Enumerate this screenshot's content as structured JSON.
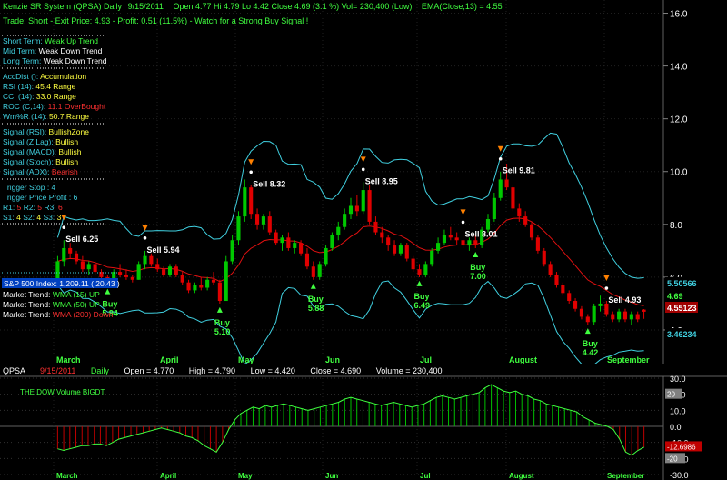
{
  "header": {
    "title": "Kenzie SR System (QPSA) Daily",
    "date": "9/15/2011",
    "ohlc": "Open 4.77   Hi 4.79   Lo 4.42   Close 4.69  (3.1 %)   Vol= 230,400 (Low)",
    "ema": "EMA(Close,13) = 4.55",
    "trade": "Trade: Short - Exit Price: 4.93 - Profit: 0.51 (11.5%) - Watch for a Strong Buy Signal !"
  },
  "info": {
    "trend": [
      {
        "label": "Short Term:",
        "value": "Weak Up Trend",
        "color": "#40ff40"
      },
      {
        "label": "Mid Term:",
        "value": "Weak Down Trend",
        "color": "#ffffff"
      },
      {
        "label": "Long Term:",
        "value": "Weak Down Trend",
        "color": "#ffffff"
      }
    ],
    "indicators": [
      {
        "label": "AccDist ():",
        "value": "Accumulation",
        "color": "#ffff40"
      },
      {
        "label": "RSI (14):",
        "value": "45.4 Range",
        "color": "#ffff40"
      },
      {
        "label": "CCI (14):",
        "value": "33.0 Range",
        "color": "#ffff40"
      },
      {
        "label": "ROC (C,14):",
        "value": "11.1 OverBought",
        "color": "#ff3030"
      },
      {
        "label": "Wm%R (14):",
        "value": "50.7 Range",
        "color": "#ffff40"
      }
    ],
    "signals": [
      {
        "label": "Signal (RSI):",
        "value": "BullishZone",
        "color": "#ffff40"
      },
      {
        "label": "Signal (Z Lag):",
        "value": "Bullish",
        "color": "#ffff40"
      },
      {
        "label": "Signal (MACD):",
        "value": "Bullish",
        "color": "#ffff40"
      },
      {
        "label": "Signal (Stoch):",
        "value": "Bullish",
        "color": "#ffff40"
      },
      {
        "label": "Signal (ADX):",
        "value": "Bearish",
        "color": "#ff3030"
      }
    ],
    "trigger": {
      "stop": "Trigger Stop : 4",
      "profit": "Trigger Price Profit : 6",
      "r_prefix": "R1:",
      "r1": "5",
      "r2": "5",
      "r3": "6",
      "s_prefix": "S1:",
      "s1": "4",
      "s2": "4",
      "s3": "3"
    },
    "market": {
      "sp500": "S&P 500 Index: 1,209.11 ( 20.43 )",
      "trends": [
        {
          "label": "Market Trend:",
          "value": "WMA (15) UP",
          "color": "#40ff40"
        },
        {
          "label": "Market Trend:",
          "value": "WMA (50) UP",
          "color": "#40ff40"
        },
        {
          "label": "Market Trend:",
          "value": "WMA (200) Down",
          "color": "#ff3030"
        }
      ]
    }
  },
  "colors": {
    "up": "#00c800",
    "down": "#e00000",
    "band": "#40d0e0",
    "ema": "#e01010",
    "buy": "#40ff40",
    "sell": "#ffffff",
    "arrow": "#ff8000",
    "text": "#40ff40"
  },
  "chart_data": [
    {
      "type": "candlestick",
      "title": "Kenzie SR System (QPSA) Daily",
      "ylim": [
        3.0,
        16.5
      ],
      "y_ticks": [
        "4.0",
        "6.0",
        "8.0",
        "10.0",
        "12.0",
        "14.0",
        "16.0"
      ],
      "y_labels": {
        "upper_band": "5.50566",
        "last": "4.69",
        "ema": "4.55123",
        "lower_band": "3.46234"
      },
      "x_months": [
        "March",
        "April",
        "May",
        "Jun",
        "Jul",
        "August",
        "September"
      ],
      "ohlc": [
        [
          5.9,
          6.8,
          5.8,
          6.6
        ],
        [
          6.6,
          7.4,
          6.4,
          7.1
        ],
        [
          7.1,
          7.3,
          6.7,
          6.9
        ],
        [
          6.9,
          7.0,
          6.5,
          6.6
        ],
        [
          6.6,
          6.8,
          6.2,
          6.3
        ],
        [
          6.3,
          6.6,
          6.1,
          6.5
        ],
        [
          6.5,
          6.6,
          6.1,
          6.2
        ],
        [
          6.2,
          6.3,
          5.9,
          6.0
        ],
        [
          6.0,
          6.1,
          5.7,
          5.8
        ],
        [
          5.8,
          6.3,
          5.7,
          6.2
        ],
        [
          6.2,
          6.5,
          6.0,
          6.1
        ],
        [
          6.1,
          6.3,
          5.9,
          6.0
        ],
        [
          6.0,
          6.1,
          5.8,
          5.9
        ],
        [
          5.9,
          6.6,
          5.9,
          6.5
        ],
        [
          6.5,
          7.0,
          6.3,
          6.8
        ],
        [
          6.8,
          6.9,
          6.4,
          6.5
        ],
        [
          6.5,
          6.7,
          6.2,
          6.3
        ],
        [
          6.3,
          6.4,
          6.0,
          6.1
        ],
        [
          6.1,
          6.5,
          6.0,
          6.4
        ],
        [
          6.4,
          6.5,
          6.0,
          6.1
        ],
        [
          6.1,
          6.2,
          5.7,
          5.8
        ],
        [
          5.8,
          5.9,
          5.4,
          5.5
        ],
        [
          5.5,
          5.8,
          5.4,
          5.7
        ],
        [
          5.7,
          6.0,
          5.5,
          5.6
        ],
        [
          5.6,
          6.0,
          5.5,
          5.9
        ],
        [
          5.9,
          6.2,
          5.7,
          5.8
        ],
        [
          5.8,
          5.9,
          5.0,
          5.1
        ],
        [
          5.1,
          6.8,
          5.1,
          6.6
        ],
        [
          6.6,
          7.6,
          6.5,
          7.4
        ],
        [
          7.4,
          8.5,
          7.2,
          8.3
        ],
        [
          8.3,
          9.7,
          8.1,
          9.4
        ],
        [
          9.4,
          9.5,
          8.2,
          8.4
        ],
        [
          8.4,
          8.6,
          7.8,
          8.0
        ],
        [
          8.0,
          8.4,
          7.8,
          8.3
        ],
        [
          8.3,
          8.5,
          7.6,
          7.7
        ],
        [
          7.7,
          7.8,
          7.2,
          7.3
        ],
        [
          7.3,
          7.6,
          7.0,
          7.5
        ],
        [
          7.5,
          7.7,
          7.0,
          7.1
        ],
        [
          7.1,
          7.4,
          6.9,
          7.3
        ],
        [
          7.3,
          7.4,
          6.8,
          6.9
        ],
        [
          6.9,
          7.1,
          6.3,
          6.4
        ],
        [
          6.4,
          6.6,
          5.9,
          6.0
        ],
        [
          6.0,
          6.6,
          5.9,
          6.5
        ],
        [
          6.5,
          7.2,
          6.4,
          7.1
        ],
        [
          7.1,
          7.7,
          7.0,
          7.6
        ],
        [
          7.6,
          8.1,
          7.4,
          7.9
        ],
        [
          7.9,
          8.6,
          7.8,
          8.4
        ],
        [
          8.4,
          9.0,
          8.2,
          8.7
        ],
        [
          8.7,
          9.1,
          8.3,
          8.5
        ],
        [
          8.5,
          9.6,
          8.4,
          9.3
        ],
        [
          9.3,
          9.5,
          8.0,
          8.1
        ],
        [
          8.1,
          8.3,
          7.6,
          7.7
        ],
        [
          7.7,
          7.9,
          7.3,
          7.5
        ],
        [
          7.5,
          7.6,
          7.0,
          7.2
        ],
        [
          7.2,
          7.4,
          6.8,
          6.9
        ],
        [
          6.9,
          7.3,
          6.8,
          7.2
        ],
        [
          7.2,
          7.3,
          6.6,
          6.7
        ],
        [
          6.7,
          6.8,
          6.2,
          6.3
        ],
        [
          6.3,
          6.5,
          6.0,
          6.1
        ],
        [
          6.1,
          6.6,
          6.0,
          6.5
        ],
        [
          6.5,
          7.1,
          6.4,
          7.0
        ],
        [
          7.0,
          7.5,
          6.9,
          7.3
        ],
        [
          7.3,
          7.8,
          7.2,
          7.6
        ],
        [
          7.6,
          7.9,
          7.4,
          7.5
        ],
        [
          7.5,
          7.7,
          7.2,
          7.4
        ],
        [
          7.4,
          7.6,
          7.1,
          7.2
        ],
        [
          7.2,
          7.5,
          7.0,
          7.4
        ],
        [
          7.4,
          7.6,
          7.1,
          7.2
        ],
        [
          7.2,
          7.9,
          7.1,
          7.8
        ],
        [
          7.8,
          8.4,
          7.7,
          8.2
        ],
        [
          8.2,
          9.2,
          8.1,
          9.0
        ],
        [
          9.0,
          10.0,
          8.9,
          9.7
        ],
        [
          9.7,
          10.3,
          9.3,
          9.4
        ],
        [
          9.4,
          9.5,
          8.5,
          8.6
        ],
        [
          8.6,
          8.8,
          8.1,
          8.3
        ],
        [
          8.3,
          8.5,
          7.9,
          8.0
        ],
        [
          8.0,
          8.1,
          7.4,
          7.5
        ],
        [
          7.5,
          7.6,
          6.9,
          7.0
        ],
        [
          7.0,
          7.1,
          6.4,
          6.5
        ],
        [
          6.5,
          6.6,
          6.0,
          6.1
        ],
        [
          6.1,
          6.2,
          5.6,
          5.7
        ],
        [
          5.7,
          5.8,
          5.3,
          5.4
        ],
        [
          5.4,
          5.5,
          5.0,
          5.1
        ],
        [
          5.1,
          5.2,
          4.7,
          4.8
        ],
        [
          4.8,
          4.9,
          4.4,
          4.5
        ],
        [
          4.5,
          4.6,
          4.2,
          4.3
        ],
        [
          4.3,
          5.0,
          4.2,
          4.9
        ],
        [
          4.9,
          5.3,
          4.7,
          5.0
        ],
        [
          5.0,
          5.1,
          4.5,
          4.6
        ],
        [
          4.6,
          4.7,
          4.3,
          4.4
        ],
        [
          4.4,
          4.8,
          4.3,
          4.7
        ],
        [
          4.7,
          4.8,
          4.3,
          4.4
        ],
        [
          4.4,
          4.7,
          4.2,
          4.6
        ],
        [
          4.6,
          4.7,
          4.3,
          4.4
        ],
        [
          4.77,
          4.79,
          4.42,
          4.69
        ]
      ],
      "signals": [
        {
          "type": "sell",
          "label": "Sell 6.25",
          "index": 1
        },
        {
          "type": "sell",
          "label": "Sell 5.94",
          "index": 14
        },
        {
          "type": "sell",
          "label": "Sell 8.32",
          "index": 31
        },
        {
          "type": "sell",
          "label": "Sell 8.95",
          "index": 49
        },
        {
          "type": "sell",
          "label": "Sell 8.01",
          "index": 65
        },
        {
          "type": "sell",
          "label": "Sell 9.81",
          "index": 71
        },
        {
          "type": "sell",
          "label": "Sell 4.93",
          "index": 88
        },
        {
          "type": "buy",
          "label": "Buy 5.94",
          "index": 8
        },
        {
          "type": "buy",
          "label": "Buy 5.10",
          "index": 26
        },
        {
          "type": "buy",
          "label": "Buy 5.88",
          "index": 41
        },
        {
          "type": "buy",
          "label": "Buy 6.49",
          "index": 58
        },
        {
          "type": "buy",
          "label": "Buy 7.00",
          "index": 67
        },
        {
          "type": "buy",
          "label": "Buy 4.42",
          "index": 85
        }
      ]
    },
    {
      "type": "area",
      "title": "THE DOW Volume BIGDT",
      "ylim": [
        -30,
        30
      ],
      "y_ticks": [
        "30.0",
        "20.0",
        "10.0",
        "0.0",
        "-10.0",
        "-20.0",
        "-30.0"
      ],
      "y_labels": {
        "upper": "20",
        "lower": "-20",
        "last": "-12.6986"
      },
      "x_months": [
        "March",
        "April",
        "May",
        "Jun",
        "Jul",
        "August",
        "September"
      ],
      "values": [
        -14,
        -15,
        -14,
        -13,
        -12,
        -12,
        -11,
        -11,
        -12,
        -10,
        -8,
        -7,
        -6,
        -5,
        -4,
        -3,
        -2,
        -1,
        -2,
        -3,
        -4,
        -6,
        -7,
        -9,
        -12,
        -14,
        -16,
        -10,
        -2,
        4,
        8,
        10,
        12,
        11,
        13,
        12,
        13,
        14,
        13,
        12,
        11,
        10,
        11,
        12,
        13,
        14,
        15,
        17,
        18,
        17,
        16,
        15,
        14,
        13,
        14,
        15,
        14,
        13,
        12,
        13,
        14,
        16,
        18,
        19,
        18,
        17,
        18,
        19,
        20,
        21,
        24,
        26,
        24,
        22,
        21,
        22,
        20,
        19,
        17,
        16,
        14,
        13,
        12,
        11,
        10,
        9,
        6,
        4,
        2,
        1,
        0,
        -2,
        -8,
        -16,
        -18,
        -15,
        -13
      ]
    }
  ],
  "lower_panel_header": {
    "symbol": "QPSA",
    "date": "9/15/2011",
    "period": "Daily",
    "open": "Open =  4.770",
    "high": "High =  4.790",
    "low": "Low =  4.420",
    "close": "Close =  4.690",
    "volume": "Volume = 230,400"
  }
}
